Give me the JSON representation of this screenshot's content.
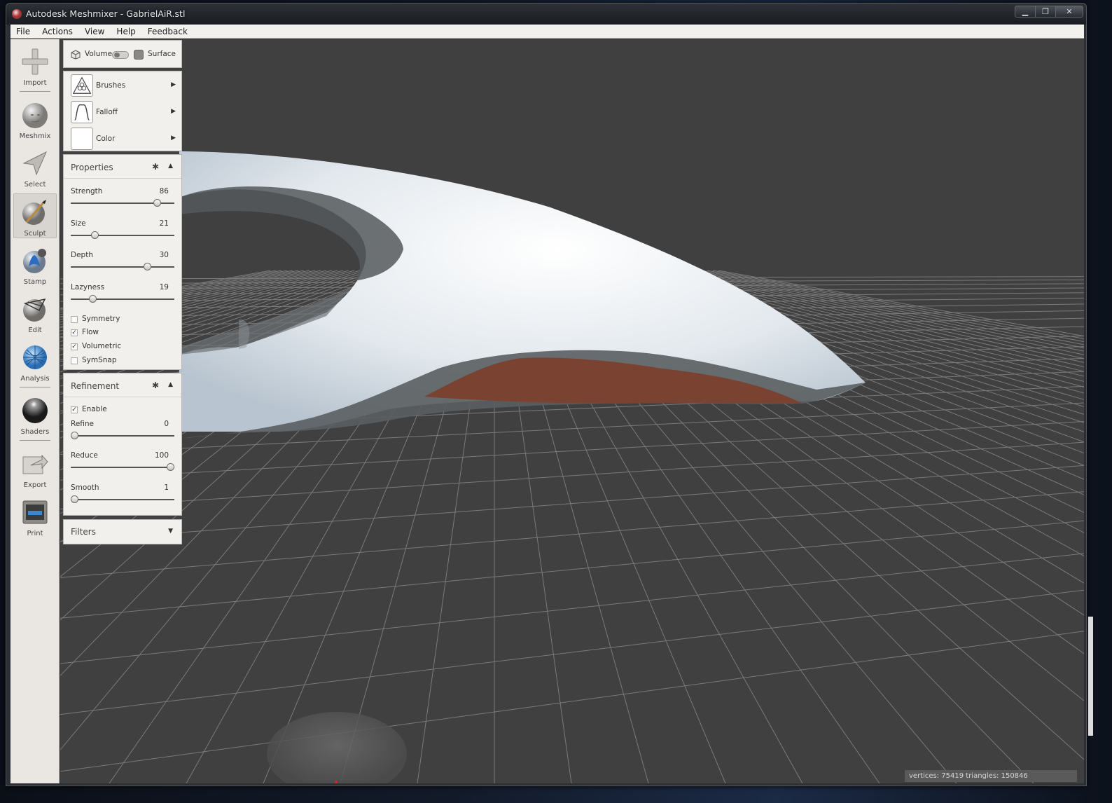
{
  "window": {
    "title": "Autodesk Meshmixer - GabrielAiR.stl",
    "minimize_label": "▁",
    "maximize_label": "❐",
    "close_label": "✕"
  },
  "menu": [
    "File",
    "Actions",
    "View",
    "Help",
    "Feedback"
  ],
  "toolbar": {
    "tools": [
      {
        "label": "Import",
        "icon": "import-icon"
      },
      {
        "label": "Meshmix",
        "icon": "meshmix-icon"
      },
      {
        "label": "Select",
        "icon": "select-icon"
      },
      {
        "label": "Sculpt",
        "icon": "sculpt-icon",
        "active": true
      },
      {
        "label": "Stamp",
        "icon": "stamp-icon"
      },
      {
        "label": "Edit",
        "icon": "edit-icon"
      },
      {
        "label": "Analysis",
        "icon": "analysis-icon"
      },
      {
        "label": "Shaders",
        "icon": "shaders-icon"
      },
      {
        "label": "Export",
        "icon": "export-icon"
      },
      {
        "label": "Print",
        "icon": "print-icon"
      }
    ]
  },
  "mode": {
    "volume_label": "Volume",
    "surface_label": "Surface"
  },
  "tool_menu": {
    "brushes_label": "Brushes",
    "falloff_label": "Falloff",
    "color_label": "Color"
  },
  "properties": {
    "title": "Properties",
    "strength": {
      "label": "Strength",
      "value": "86",
      "fraction": 0.86
    },
    "size": {
      "label": "Size",
      "value": "21",
      "fraction": 0.21
    },
    "depth": {
      "label": "Depth",
      "value": "30",
      "fraction": 0.76
    },
    "lazyness": {
      "label": "Lazyness",
      "value": "19",
      "fraction": 0.19
    },
    "checks": [
      {
        "label": "Symmetry",
        "checked": false
      },
      {
        "label": "Flow",
        "checked": true
      },
      {
        "label": "Volumetric",
        "checked": true
      },
      {
        "label": "SymSnap",
        "checked": false
      }
    ]
  },
  "refinement": {
    "title": "Refinement",
    "enable_label": "Enable",
    "enable_checked": true,
    "refine": {
      "label": "Refine",
      "value": "0",
      "fraction": 0.0
    },
    "reduce": {
      "label": "Reduce",
      "value": "100",
      "fraction": 1.0
    },
    "smooth": {
      "label": "Smooth",
      "value": "1",
      "fraction": 0.0
    }
  },
  "filters": {
    "title": "Filters"
  },
  "status": {
    "text": "vertices: 75419 triangles: 150846"
  },
  "colors": {
    "viewport_bg": "#404040",
    "grid_line": "#7a7a7a",
    "mesh": "#e9eef2",
    "mesh_shadow": "#5a5e61",
    "selection": "#7a4331"
  }
}
